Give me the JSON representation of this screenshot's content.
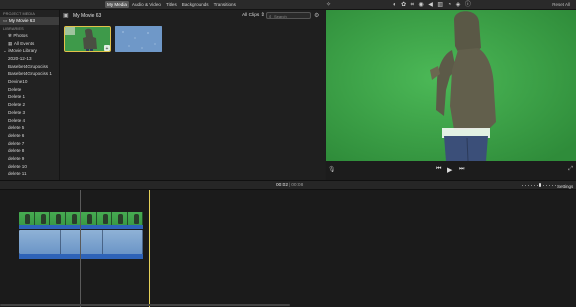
{
  "top_tabs": [
    {
      "label": "My Media",
      "active": true
    },
    {
      "label": "Audio & Video",
      "active": false
    },
    {
      "label": "Titles",
      "active": false
    },
    {
      "label": "Backgrounds",
      "active": false
    },
    {
      "label": "Transitions",
      "active": false
    }
  ],
  "top_tools": [
    "enhance-wand-icon",
    "color-balance-icon",
    "color-correction-icon",
    "crop-icon",
    "stabilization-icon",
    "volume-icon",
    "noise-reduction-icon",
    "speed-icon",
    "filter-icon",
    "info-icon"
  ],
  "reset_all": "Reset All",
  "sidebar": {
    "project_media_header": "PROJECT MEDIA",
    "project_item": "My Movie 63",
    "libraries_header": "LIBRARIES",
    "library_items": [
      "Photos",
      "All Events"
    ],
    "library_name": "iMovie Library",
    "events": [
      "2020-12-13",
      "Basebet4Grupociss",
      "Basebet4Grupociss 1",
      "Devine10",
      "Delete",
      "Delete 1",
      "Delete 2",
      "Delete 3",
      "Delete 4",
      "delete 5",
      "delete 6",
      "delete 7",
      "delete 8",
      "delete 9",
      "delete 10",
      "delete 11"
    ]
  },
  "browser": {
    "title": "My Movie 63",
    "filter": "All Clips ⇕",
    "search_placeholder": "Search"
  },
  "clip1_badge": "+",
  "timecode": {
    "current": "00:02",
    "duration": "00:08"
  },
  "settings_label": "Settings",
  "colors": {
    "accent": "#e3c24a",
    "green_screen": "#3aa247",
    "audio_track": "#2e63b8",
    "selected_tab": "#585858"
  }
}
